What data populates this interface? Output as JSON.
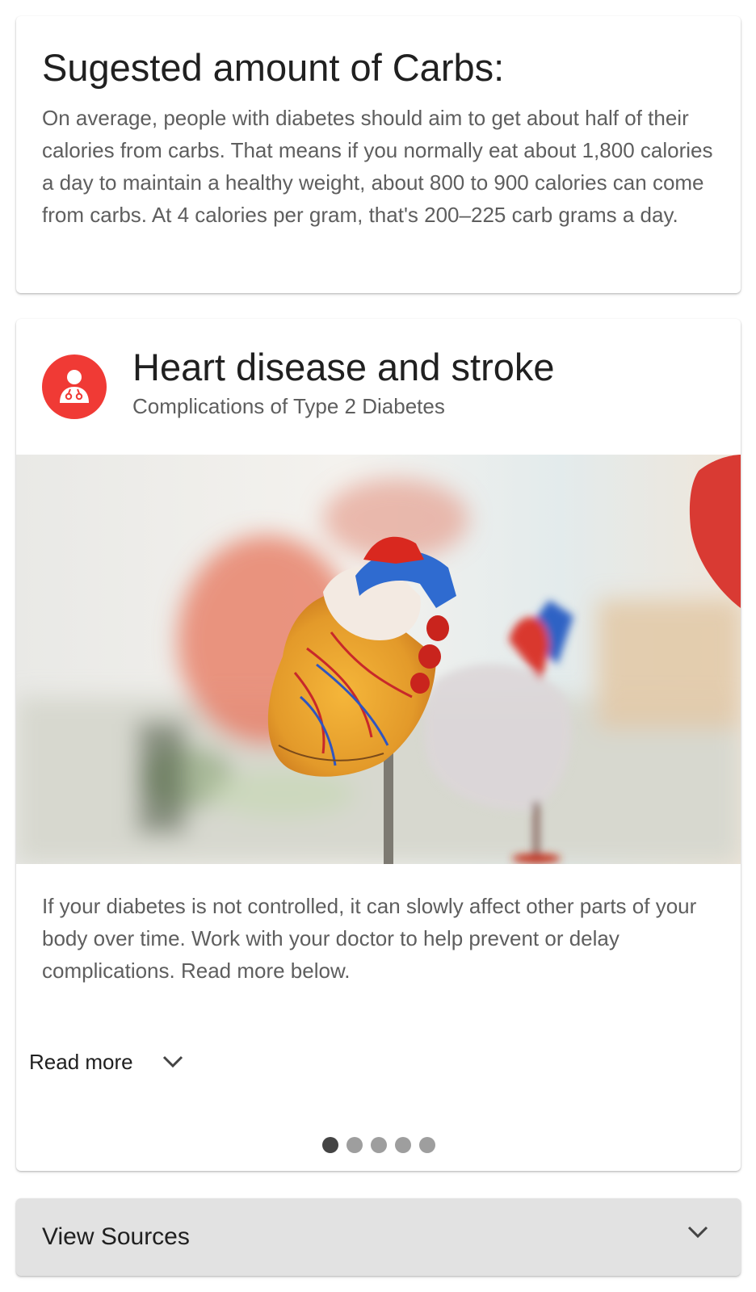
{
  "carbs_card": {
    "title": "Sugested amount of Carbs:",
    "body": "On average, people with diabetes should aim to get about half of their calories from carbs. That means if you normally eat about 1,800 calories a day to maintain a healthy weight, about 800 to 900 calories can come from carbs. At 4 calories per gram, that's 200–225 carb grams a day."
  },
  "heart_card": {
    "avatar_icon": "doctor-icon",
    "accent_color": "#f03a35",
    "title": "Heart disease and stroke",
    "subtitle": "Complications of Type 2 Diabetes",
    "image": "anatomical-heart-model-photo",
    "body": "If your diabetes is not controlled, it can slowly affect other parts of your body over time. Work with your doctor to help prevent or delay complications. Read more below.",
    "read_more_label": "Read more",
    "carousel": {
      "total": 5,
      "active": 1
    }
  },
  "sources": {
    "label": "View Sources",
    "icon": "chevron-down-icon"
  }
}
